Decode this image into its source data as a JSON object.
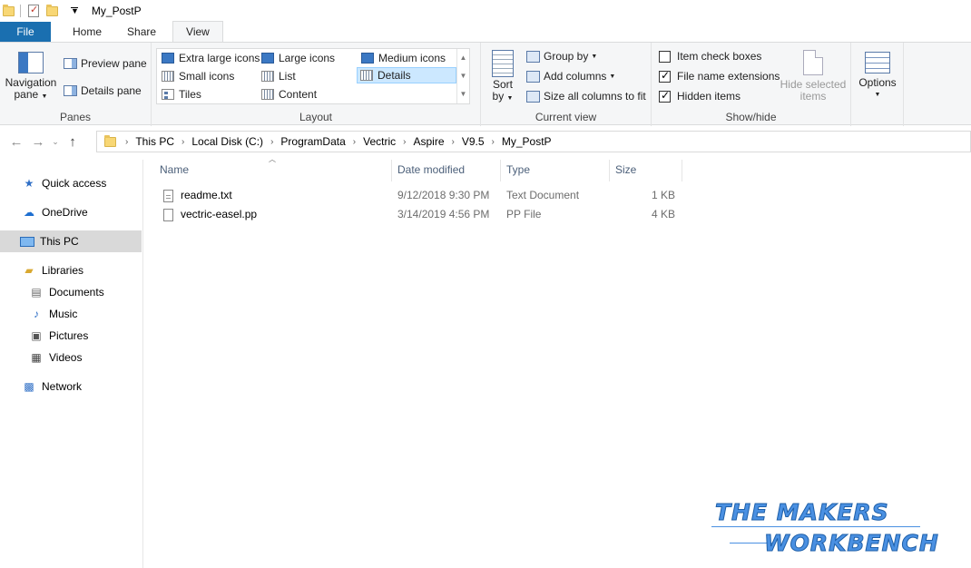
{
  "window": {
    "title": "My_PostP"
  },
  "tabs": [
    {
      "label": "File"
    },
    {
      "label": "Home"
    },
    {
      "label": "Share"
    },
    {
      "label": "View"
    }
  ],
  "ribbon": {
    "panes": {
      "label": "Panes",
      "navigation_pane_line1": "Navigation",
      "navigation_pane_line2": "pane",
      "preview_pane": "Preview pane",
      "details_pane": "Details pane"
    },
    "layout": {
      "label": "Layout",
      "items": [
        "Extra large icons",
        "Large icons",
        "Medium icons",
        "Small icons",
        "List",
        "Details",
        "Tiles",
        "Content"
      ],
      "selected": "Details"
    },
    "current_view": {
      "label": "Current view",
      "sort_line1": "Sort",
      "sort_line2": "by",
      "group_by": "Group by",
      "add_columns": "Add columns",
      "size_columns": "Size all columns to fit"
    },
    "show_hide": {
      "label": "Show/hide",
      "item_check_boxes": {
        "label": "Item check boxes",
        "checked": false
      },
      "file_name_extensions": {
        "label": "File name extensions",
        "checked": true
      },
      "hidden_items": {
        "label": "Hidden items",
        "checked": true
      },
      "hide_selected_line1": "Hide selected",
      "hide_selected_line2": "items"
    },
    "options": {
      "label": "Options"
    }
  },
  "address": {
    "crumbs": [
      "This PC",
      "Local Disk (C:)",
      "ProgramData",
      "Vectric",
      "Aspire",
      "V9.5",
      "My_PostP"
    ]
  },
  "nav": {
    "quick_access": "Quick access",
    "onedrive": "OneDrive",
    "this_pc": "This PC",
    "libraries": "Libraries",
    "documents": "Documents",
    "music": "Music",
    "pictures": "Pictures",
    "videos": "Videos",
    "network": "Network"
  },
  "columns": {
    "name": "Name",
    "date": "Date modified",
    "type": "Type",
    "size": "Size"
  },
  "files": [
    {
      "name": "readme.txt",
      "date": "9/12/2018 9:30 PM",
      "type": "Text Document",
      "size": "1 KB",
      "icon": "text-file-icon"
    },
    {
      "name": "vectric-easel.pp",
      "date": "3/14/2019 4:56 PM",
      "type": "PP File",
      "size": "4 KB",
      "icon": "blank-file-icon"
    }
  ],
  "watermark": {
    "line1": "THE MAKERS",
    "line2": "WORKBENCH"
  }
}
